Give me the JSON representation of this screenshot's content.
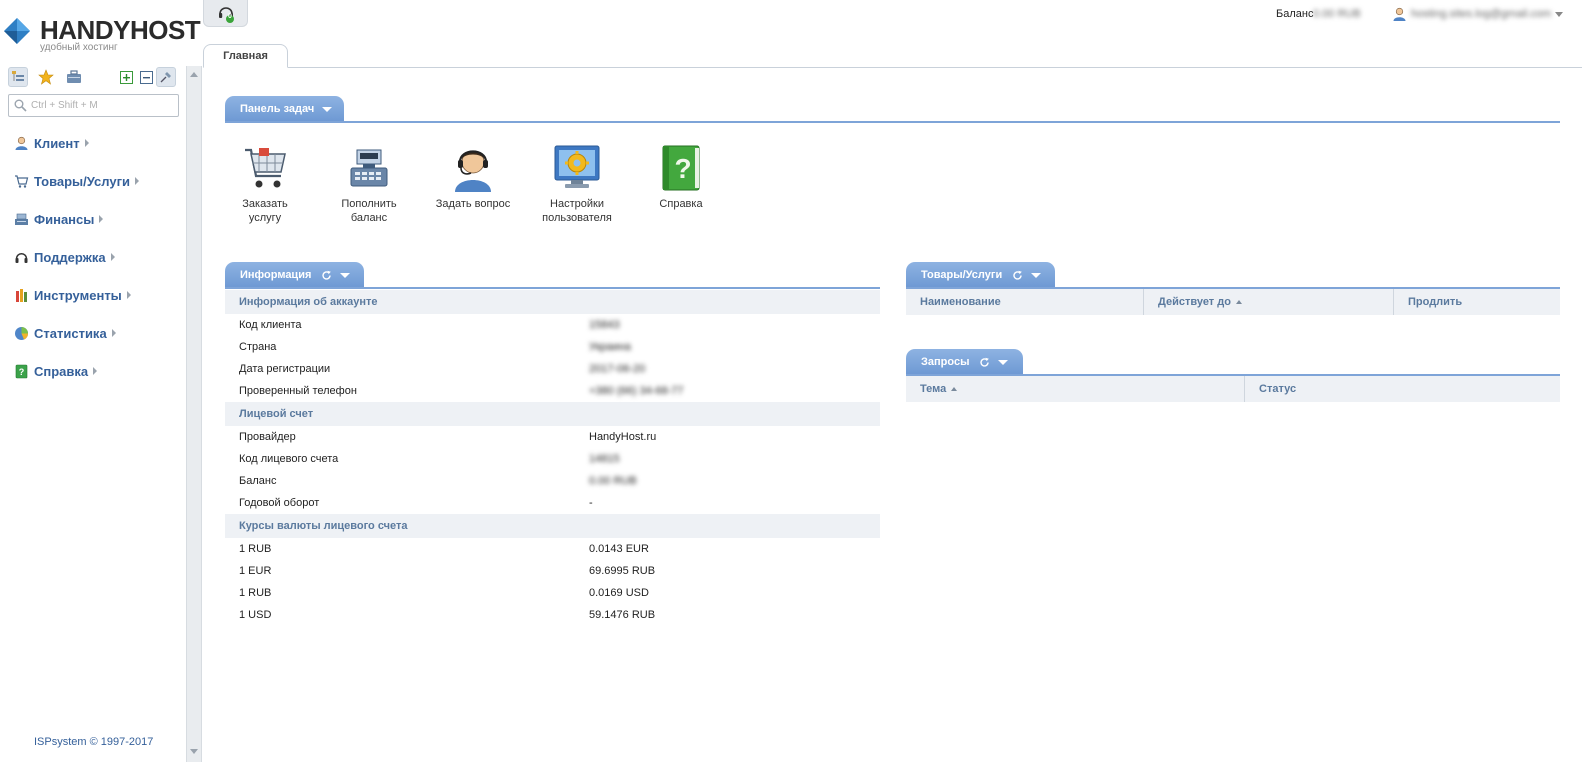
{
  "brand": {
    "name": "HANDYHOST",
    "tagline": "удобный хостинг"
  },
  "sidebar": {
    "search_placeholder": "Ctrl + Shift + M",
    "items": [
      {
        "label": "Клиент",
        "icon": "user-icon"
      },
      {
        "label": "Товары/Услуги",
        "icon": "cart-icon"
      },
      {
        "label": "Финансы",
        "icon": "cash-register-icon"
      },
      {
        "label": "Поддержка",
        "icon": "headset-icon"
      },
      {
        "label": "Инструменты",
        "icon": "tools-icon"
      },
      {
        "label": "Статистика",
        "icon": "pie-chart-icon"
      },
      {
        "label": "Справка",
        "icon": "help-book-icon"
      }
    ],
    "copyright": "ISPsystem © 1997-2017"
  },
  "header": {
    "notifications_count": "0",
    "balance_label": "Баланс",
    "balance_value": "0.00 RUB",
    "user_email": "hosting.sites.log@gmail.com"
  },
  "tabs": {
    "main": "Главная"
  },
  "task_panel": {
    "title": "Панель задач",
    "tasks": [
      {
        "label": "Заказать услугу",
        "icon": "shopping-cart-icon"
      },
      {
        "label": "Пополнить баланс",
        "icon": "cash-register-icon"
      },
      {
        "label": "Задать вопрос",
        "icon": "support-agent-icon"
      },
      {
        "label": "Настройки пользователя",
        "icon": "monitor-gear-icon"
      },
      {
        "label": "Справка",
        "icon": "help-book-icon"
      }
    ]
  },
  "info_panel": {
    "title": "Информация",
    "sections": {
      "account": {
        "title": "Информация об аккаунте",
        "rows": [
          {
            "key": "Код клиента",
            "value": "15843"
          },
          {
            "key": "Страна",
            "value": "Украина"
          },
          {
            "key": "Дата регистрации",
            "value": "2017-06-20"
          },
          {
            "key": "Проверенный телефон",
            "value": "+380 (66) 34-68-77"
          }
        ]
      },
      "personal_account": {
        "title": "Лицевой счет",
        "rows": [
          {
            "key": "Провайдер",
            "value": "HandyHost.ru"
          },
          {
            "key": "Код лицевого счета",
            "value": "14815"
          },
          {
            "key": "Баланс",
            "value": "0.00 RUB"
          },
          {
            "key": "Годовой оборот",
            "value": "-"
          }
        ]
      },
      "rates": {
        "title": "Курсы валюты лицевого счета",
        "rows": [
          {
            "key": "1 RUB",
            "value": "0.0143 EUR"
          },
          {
            "key": "1 EUR",
            "value": "69.6995 RUB"
          },
          {
            "key": "1 RUB",
            "value": "0.0169 USD"
          },
          {
            "key": "1 USD",
            "value": "59.1476 RUB"
          }
        ]
      }
    }
  },
  "services_panel": {
    "title": "Товары/Услуги",
    "columns": [
      "Наименование",
      "Действует до",
      "Продлить"
    ]
  },
  "requests_panel": {
    "title": "Запросы",
    "columns": [
      "Тема",
      "Статус"
    ]
  }
}
